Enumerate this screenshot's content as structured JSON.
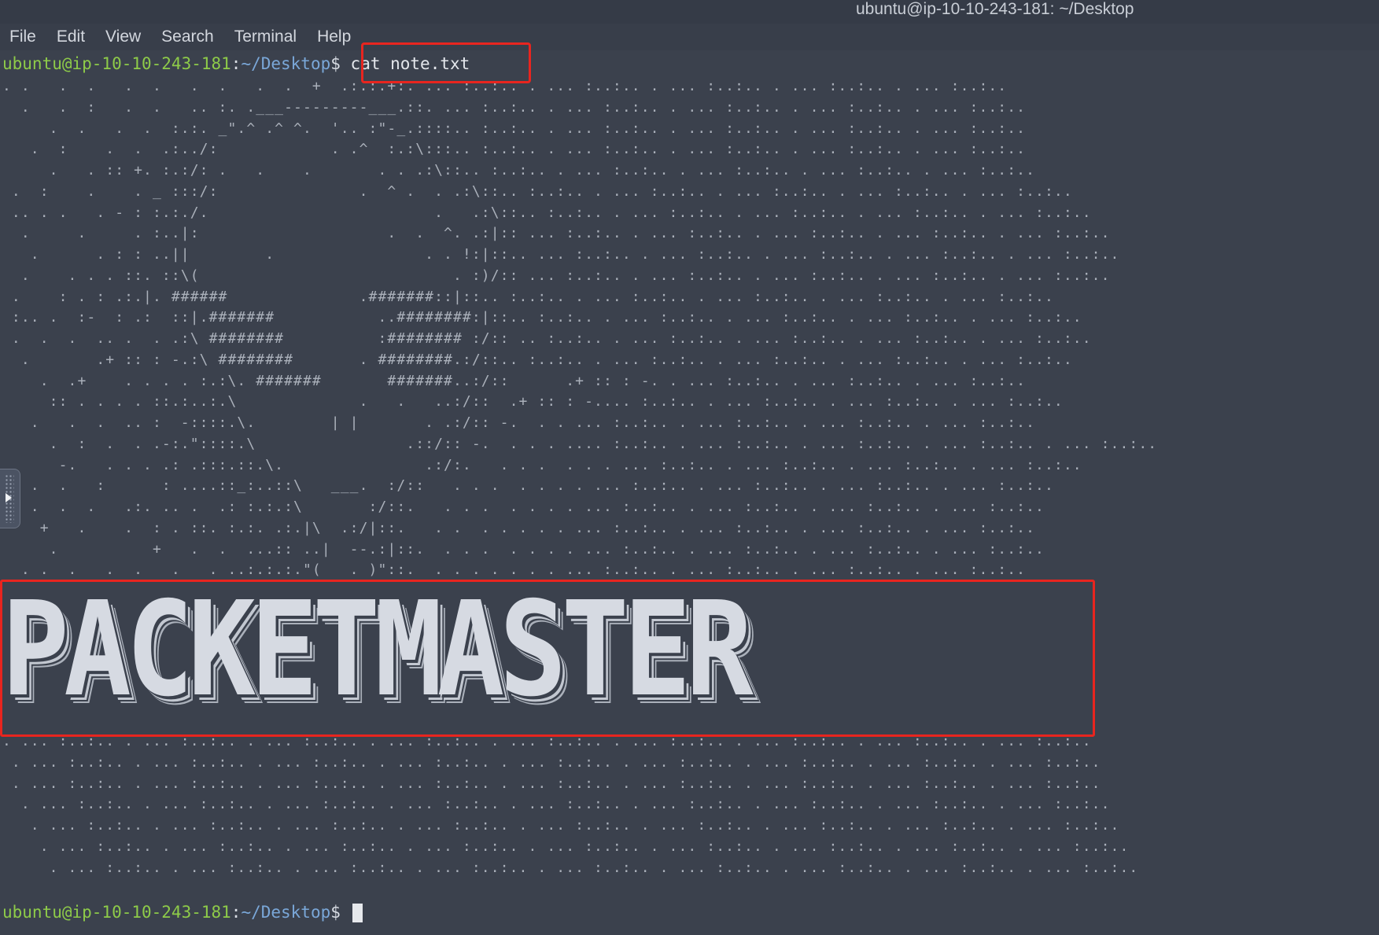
{
  "window": {
    "title": "ubuntu@ip-10-10-243-181: ~/Desktop"
  },
  "menu": [
    "File",
    "Edit",
    "View",
    "Search",
    "Terminal",
    "Help"
  ],
  "prompt": {
    "user_host": "ubuntu@ip-10-10-243-181",
    "sep": ":",
    "path": "~/Desktop",
    "symbol": "$ "
  },
  "command": "cat note.txt",
  "ascii_art": ". .   .  .   .  .   .  .   .  .  +  .:.:.+:. ... :..:.. . ... :..:.. . ... :..:.. . ... :..:.. . ... :..:..\n  .   .  :   .  .   .. :. .___---------___.::. ... :..:.. . ... :..:.. . ... :..:.. . ... :..:.. . ... :..:..\n     .  .   .  .  :.:. _\".^ .^ ^.  '.. :\"-_.::::.. :..:.. . ... :..:.. . ... :..:.. . ... :..:.. . ... :..:..\n   .  :    .  .  .:../:            . .^  :.:\\:::.. :..:.. . ... :..:.. . ... :..:.. . ... :..:.. . ... :..:..\n     .   . :: +. :.:/: .   .    .       . . .:\\::.. :..:.. . ... :..:.. . ... :..:.. . ... :..:.. . ... :..:..\n .  :    .    . _ :::/:               .  ^ .  . .:\\::.. :..:.. . ... :..:.. . ... :..:.. . ... :..:.. . ... :..:..\n .. . .   . - : :.:./.                        .   .:\\::.. :..:.. . ... :..:.. . ... :..:.. . ... :..:.. . ... :..:..\n  .     .     . :..|:                    .  .  ^. .:|:: ... :..:.. . ... :..:.. . ... :..:.. . ... :..:.. . ... :..:..\n   .      . : : ..||        .                . . !:|::.. ... :..:.. . ... :..:.. . ... :..:.. . ... :..:.. . ... :..:..\n  .    . . . ::. ::\\(                           . :)/:: ... :..:.. . ... :..:.. . ... :..:.. . ... :..:.. . ... :..:..\n .    : . : .:.|. ######              .#######::|::.. :..:.. . ... :..:.. . ... :..:.. . ... :..:.. . ... :..:..\n :.. .  :-  : .:  ::|.#######           ..########:|::.. :..:.. . ... :..:.. . ... :..:.. . ... :..:.. . ... :..:..\n .  .  .  .. .  . .:\\ ########          :######## :/:: .. :..:.. . ... :..:.. . ... :..:.. . ... :..:.. . ... :..:..\n  .       .+ :: : -.:\\ ########       . ########.:/::.. :..:.. . ... :..:.. . ... :..:.. . ... :..:.. . ... :..:..\n    .  .+    . . . . :.:\\. #######       #######..:/::      .+ :: : -. . ... :..:.. . ... :..:.. . ... :..:..\n     :: . . . . ::.:..:.\\             .   .   ..:/::  .+ :: : -.... :..:.. . ... :..:.. . ... :..:.. . ... :..:..\n   .   .  .  .. :  -::::.\\.        | |       . .:/:: -.  . . ... :..:.. . ... :..:.. . ... :..:.. . ... :..:..\n     .  :  .  . .-:.\"::::.\\                .::/:: -.  . . . .... :..:.. . ... :..:.. . ... :..:.. . ... :..:.. . ... :..:..\n      -.   . . . .: .:::.::.\\.               .:/:.   . . .  . . . ... :..:.. . ... :..:.. . ... :..:.. . ... :..:..\n   .  .   :      : ....::_:..::\\   ___.  :/::   . . .  . . . . ... :..:.. . ... :..:.. . ... :..:.. . ... :..:..\n   .  .  .   .:. .. .  .: :.:.:\\       :/::.   . . .  . . . . ... :..:.. . ... :..:.. . ... :..:.. . ... :..:..\n    +   .    .  : . ::. :.:. .:.|\\  .:/|::.   . .  . . . . . ... :..:.. . ... :..:.. . ... :..:.. . ... :..:..\n     .          +   .  .  ...:: ..|  --.:|::.  . . .  . . . . ... :..:.. . ... :..:.. . ... :..:.. . ... :..:..\n  . .  .   .  .   .   . ..:.:.:.\"(   . )\"::.  . . . . . . . ... :..:.. . ... :..:.. . ... :..:.. . ... :..:..",
  "banner_text": "PACKETMASTER",
  "ascii_tail": ". ... :..:.. . ... :..:.. . ... :..:.. . ... :..:.. . ... :..:.. . ... :..:.. . ... :..:.. . ... :..:.. . ... :..:..\n . ... :..:.. . ... :..:.. . ... :..:.. . ... :..:.. . ... :..:.. . ... :..:.. . ... :..:.. . ... :..:.. . ... :..:..\n . ... :..:.. . ... :..:.. . ... :..:.. . ... :..:.. . ... :..:.. . ... :..:.. . ... :..:.. . ... :..:.. . ... :..:..\n  . ... :..:.. . ... :..:.. . ... :..:.. . ... :..:.. . ... :..:.. . ... :..:.. . ... :..:.. . ... :..:.. . ... :..:..\n   . ... :..:.. . ... :..:.. . ... :..:.. . ... :..:.. . ... :..:.. . ... :..:.. . ... :..:.. . ... :..:.. . ... :..:..\n    . ... :..:.. . ... :..:.. . ... :..:.. . ... :..:.. . ... :..:.. . ... :..:.. . ... :..:.. . ... :..:.. . ... :..:..\n     . ... :..:.. . ... :..:.. . ... :..:.. . ... :..:.. . ... :..:.. . ... :..:.. . ... :..:.. . ... :..:.. . ... :..:..",
  "colors": {
    "prompt_user": "#8ecb49",
    "prompt_path": "#7aa7d8",
    "highlight": "#e8251f",
    "background": "#3b414d"
  }
}
